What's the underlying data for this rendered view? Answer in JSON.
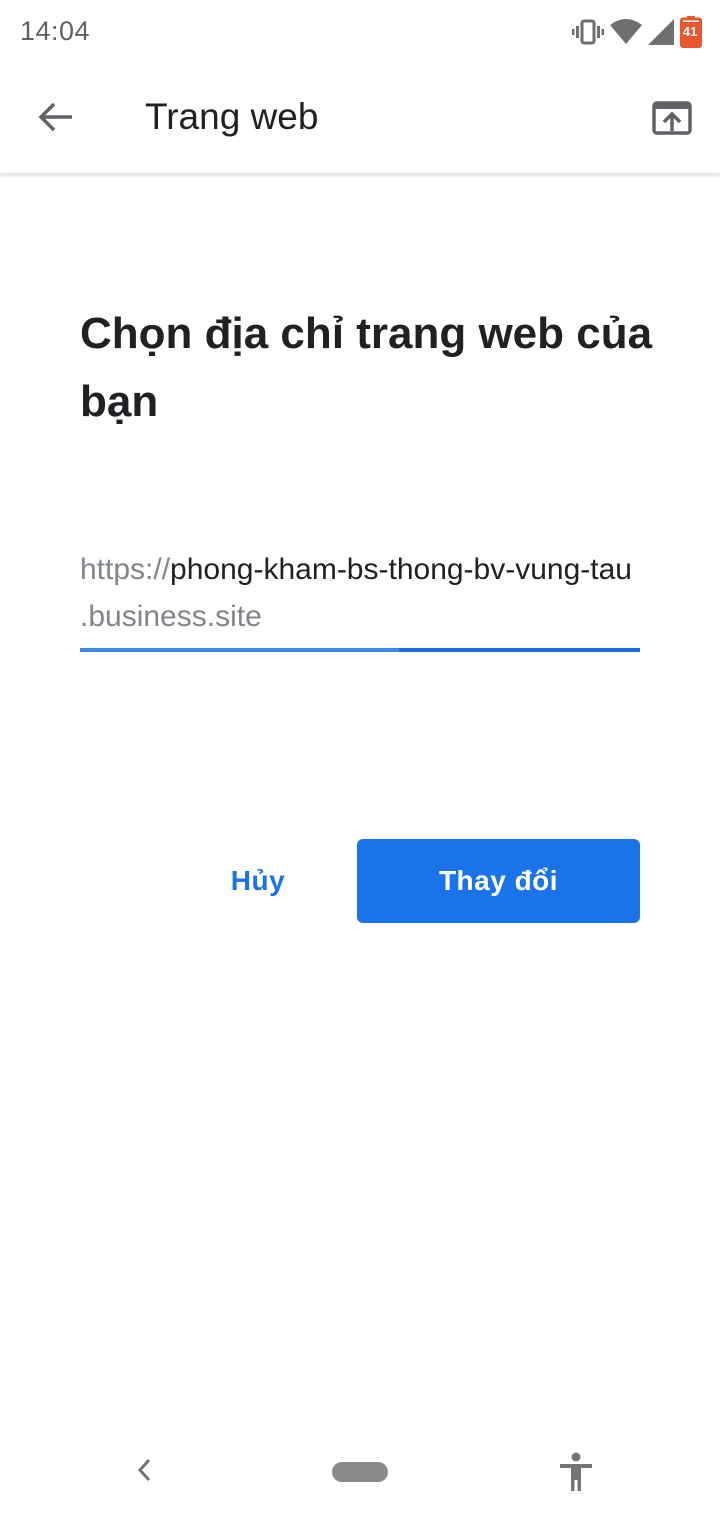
{
  "status_bar": {
    "time": "14:04",
    "battery_level": "41",
    "icons": [
      "vibrate-icon",
      "wifi-icon",
      "signal-icon",
      "battery-icon"
    ]
  },
  "app_bar": {
    "title": "Trang web",
    "back_icon": "arrow-back-icon",
    "action_icon": "open-in-browser-icon"
  },
  "main": {
    "heading": "Chọn địa chỉ trang web của bạn",
    "url": {
      "prefix": "https://",
      "value": "phong-kham-bs-thong-bv-vung-tau",
      "suffix": ".business.site"
    },
    "cancel_label": "Hủy",
    "change_label": "Thay đổi"
  },
  "nav_bar": {
    "icons": [
      "nav-back-icon",
      "home-pill-icon",
      "accessibility-icon"
    ]
  },
  "colors": {
    "accent": "#1a73e8",
    "text_primary": "#202124",
    "text_secondary": "#80868b",
    "battery": "#e8572c"
  }
}
